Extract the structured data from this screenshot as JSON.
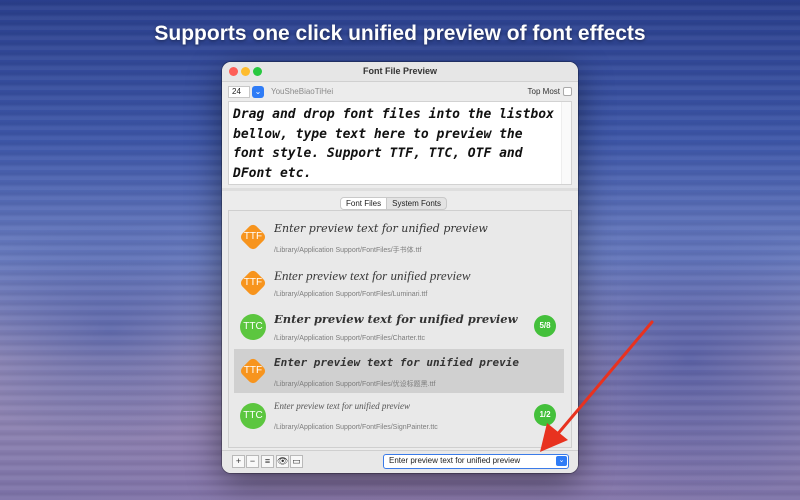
{
  "headline": "Supports one click unified preview of font effects",
  "window": {
    "title": "Font File Preview",
    "font_size": "24",
    "font_name": "YouSheBiaoTiHei",
    "top_most_label": "Top Most",
    "preview_text": "Drag and drop font files into the listbox bellow, type text here to preview the font style. Support TTF, TTC, OTF and DFont etc."
  },
  "tabs": [
    {
      "label": "Font Files",
      "active": true
    },
    {
      "label": "System Fonts",
      "active": false
    }
  ],
  "font_list": [
    {
      "type": "TTF",
      "text": "Enter preview text for unified preview",
      "path": "/Library/Application Support/FontFiles/手书体.ttf",
      "count": ""
    },
    {
      "type": "TTF",
      "text": "Enter preview text for unified preview",
      "path": "/Library/Application Support/FontFiles/Luminari.ttf",
      "count": ""
    },
    {
      "type": "TTC",
      "text": "Enter preview text for unified preview",
      "path": "/Library/Application Support/FontFiles/Charter.ttc",
      "count": "5/8"
    },
    {
      "type": "TTF",
      "text": "Enter preview text for unified previe",
      "path": "/Library/Application Support/FontFiles/优设标题黑.ttf",
      "count": "",
      "selected": true
    },
    {
      "type": "TTC",
      "text": "Enter preview text for unified preview",
      "path": "/Library/Application Support/FontFiles/SignPainter.ttc",
      "count": "1/2"
    }
  ],
  "toolbar": {
    "add": "+",
    "remove": "−",
    "list": "≡",
    "preview": "👁",
    "folder": "▭"
  },
  "search_field_value": "Enter preview text for unified preview",
  "colors": {
    "ttf_badge": "#f7941d",
    "ttc_badge": "#5cc63f",
    "accent": "#2f7cf6",
    "arrow": "#e8321f"
  }
}
